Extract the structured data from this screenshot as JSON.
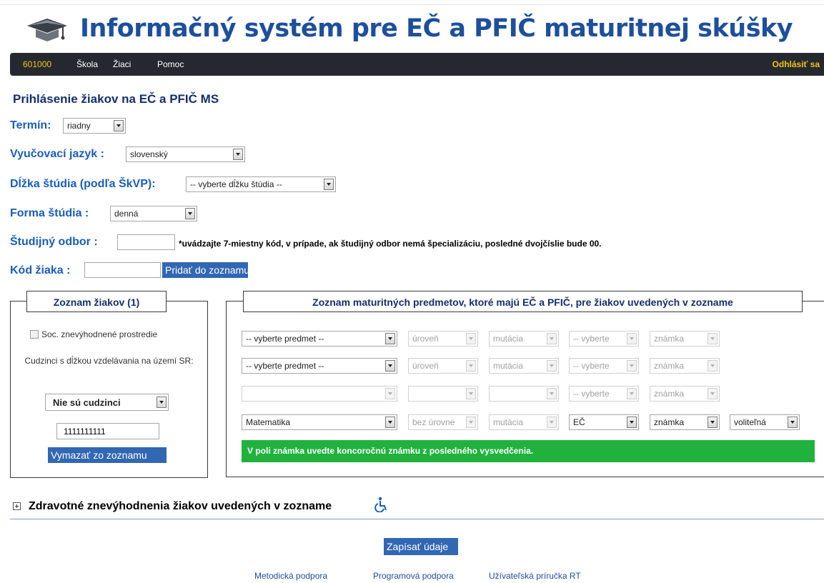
{
  "header": {
    "title": "Informačný systém pre EČ a PFIČ maturitnej skúšky"
  },
  "nav": {
    "code": "601000",
    "items": [
      "Škola",
      "Žiaci",
      "Pomoc"
    ],
    "logout": "Odhlásiť sa"
  },
  "form": {
    "heading": "Prihlásenie žiakov na EČ a PFIČ MS",
    "term_label": "Termín:",
    "term_value": "riadny",
    "language_label": "Vyučovací jazyk :",
    "language_value": "slovenský",
    "length_label": "Dĺžka štúdia (podľa ŠkVP):",
    "length_value": "-- vyberte dĺžku štúdia --",
    "form_label": "Forma štúdia :",
    "form_value": "denná",
    "field_label": "Študijný odbor :",
    "field_value": "",
    "field_note": "*uvádzajte 7-miestny kód, v prípade, ak študijný odbor nemá špecializáciu, posledné dvojčíslie bude 00.",
    "student_code_label": "Kód žiaka :",
    "student_code_value": "",
    "add_button": "Pridať do zoznamu"
  },
  "students_panel": {
    "legend": "Zoznam žiakov (1)",
    "soc_checkbox_label": "Soc. znevýhodnené prostredie",
    "foreigners_label": "Cudzinci s dĺžkou vzdelávania na území SR:",
    "foreigners_value": "Nie sú cudzinci",
    "student_id": "1111111111",
    "remove_button": "Vymazať zo zoznamu"
  },
  "subjects_panel": {
    "legend": "Zoznam maturitných predmetov, ktoré majú EČ a PFIČ, pre žiakov uvedených v zozname",
    "rows": [
      {
        "subject": "-- vyberte predmet --",
        "level": "úroveň",
        "mutation": "mutácia",
        "part": "-- vyberte",
        "grade": "známka"
      },
      {
        "subject": "-- vyberte predmet --",
        "level": "úroveň",
        "mutation": "mutácia",
        "part": "-- vyberte",
        "grade": "známka"
      },
      {
        "subject": "",
        "level": "",
        "mutation": "",
        "part": "-- vyberte",
        "grade": "známka"
      },
      {
        "subject": "Matematika",
        "level": "bez úrovne",
        "mutation": "mutácia",
        "part": "EČ",
        "grade": "známka",
        "type": "voliteľná"
      }
    ],
    "message": "V poli známka uvedte koncoročnú známku z posledného vysvedčenia."
  },
  "health": {
    "label": "Zdravotné znevýhodnenia žiakov uvedených v zozname"
  },
  "save_button": "Zapísať údaje",
  "footer": {
    "links": [
      "Metodická podpora",
      "Programová podpora",
      "Užívateľská príručka RT"
    ]
  },
  "colors": {
    "title_blue": "#1e4f9c",
    "label_blue": "#1b5db8",
    "navbar_bg": "#25292f",
    "nav_accent": "#f0c419",
    "button_blue": "#3167b3",
    "success_green": "#21b23e"
  }
}
